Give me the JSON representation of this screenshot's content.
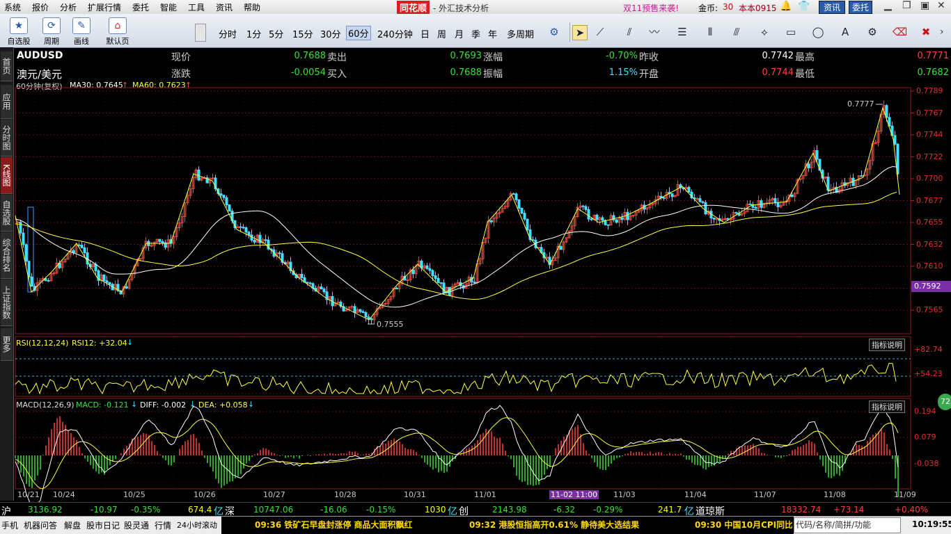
{
  "menu": [
    "系统",
    "报价",
    "分析",
    "扩展行情",
    "委托",
    "智能",
    "工具",
    "资讯",
    "帮助"
  ],
  "app_title": "同花顺",
  "window_subtitle": "- 外汇技术分析",
  "promo": "双11预售来袭!",
  "gold_label": "金币:",
  "gold_value": "30",
  "user": "本本0915",
  "btn_news": "资讯",
  "btn_trade": "委托",
  "toolbar_left": [
    {
      "icon": "star-icon",
      "label": "自选股"
    },
    {
      "icon": "cycle-icon",
      "label": "周期"
    },
    {
      "icon": "pencil-icon",
      "label": "画线"
    },
    {
      "icon": "home-icon",
      "label": "默认页"
    }
  ],
  "periods": [
    "分时",
    "1分",
    "5分",
    "15分",
    "30分",
    "60分",
    "240分钟",
    "日",
    "周",
    "月",
    "季",
    "年",
    "多周期"
  ],
  "selected_period": "60分",
  "draw_tools": [
    "cursor-icon",
    "line-icon",
    "ray-icon",
    "wave-icon",
    "fib-icon",
    "channel-icon",
    "parallel-icon",
    "rect-icon",
    "ellipse-icon",
    "text-icon",
    "gear-icon",
    "eraser-icon",
    "delete-icon"
  ],
  "sidebar_tabs": [
    "首页",
    "应用",
    "分时图",
    "K线图",
    "自选股",
    "综合排名",
    "上证指数",
    "更多"
  ],
  "active_tab": "K线图",
  "quote": {
    "symbol": "AUDUSD",
    "name": "澳元/美元",
    "current_label": "现价",
    "current": "0.7688",
    "change_label": "涨跌",
    "change": "-0.0054",
    "sell_label": "卖出",
    "sell": "0.7693",
    "buy_label": "买入",
    "buy": "0.7688",
    "pct_label": "涨幅",
    "pct": "-0.70%",
    "amp_label": "振幅",
    "amp": "1.15%",
    "prev_label": "昨收",
    "prev": "0.7742",
    "open_label": "开盘",
    "open": "0.7744",
    "high_label": "最高",
    "high": "0.7771",
    "low_label": "最低",
    "low": "0.7682"
  },
  "main_legend": {
    "period": "60分钟(复权)",
    "ma30": "MA30: 0.7645",
    "ma60": "MA60: 0.7623"
  },
  "rsi_legend": {
    "name": "RSI(12,12,24)",
    "value": "RSI12: +32.04"
  },
  "macd_legend": {
    "name": "MACD(12,26,9)",
    "macd": "MACD: -0.121",
    "diff": "DIFF: -0.002",
    "dea": "DEA: +0.058"
  },
  "indicator_button": "指标说明",
  "price_axis": [
    "0.7789",
    "0.7767",
    "0.7744",
    "0.7722",
    "0.7700",
    "0.7677",
    "0.7655",
    "0.7632",
    "0.7610",
    "0.7588",
    "0.7565"
  ],
  "current_price_tag": "0.7592",
  "rsi_axis": [
    "+82.74",
    "+54.23"
  ],
  "macd_axis": [
    "0.194",
    "0.079",
    "-0.038"
  ],
  "peak_label": "0.7777",
  "trough_label": "0.7555",
  "dates": [
    "10/21",
    "10/24",
    "10/25",
    "10/26",
    "10/27",
    "10/28",
    "10/31",
    "11/01",
    "11/02 11:00",
    "11/03",
    "11/04",
    "11/07",
    "11/08",
    "11/09"
  ],
  "highlight_date": "11-02 11:00",
  "market": {
    "sh_label": "沪",
    "sh_index": "3136.92",
    "sh_change": "-10.97",
    "sh_pct": "-0.35%",
    "sh_amount": "674.4",
    "sz_label": "深",
    "sz_index": "10747.06",
    "sz_change": "-16.06",
    "sz_pct": "-0.15%",
    "sz_amount": "1030",
    "cy_label": "创",
    "cy_index": "2143.98",
    "cy_change": "-6.32",
    "cy_pct": "-0.29%",
    "cy_amount": "241.7",
    "dj_label": "道琼斯",
    "dj_index": "18332.74",
    "dj_change": "+73.14",
    "dj_pct": "+0.40%",
    "unit_yi": "亿"
  },
  "bottom_tabs": [
    "手机",
    "机器问答",
    "解盘",
    "股市日记",
    "股灵通",
    "行情",
    "24小时滚动"
  ],
  "news": [
    "09:36 铁矿石早盘封涨停 商品大面积飘红",
    "09:32 港股恒指高开0.61% 静待美大选结果",
    "09:30 中国10月CPI同比"
  ],
  "search_hint": "代码/名称/简拼/功能",
  "clock": "10:19:55",
  "badge": "72",
  "colors": {
    "up": "#ff4040",
    "down": "#40e0ff",
    "ma30": "#ffffff",
    "ma60": "#ffff40",
    "rsi": "#ffff40",
    "accent": "#8c1a1a"
  }
}
